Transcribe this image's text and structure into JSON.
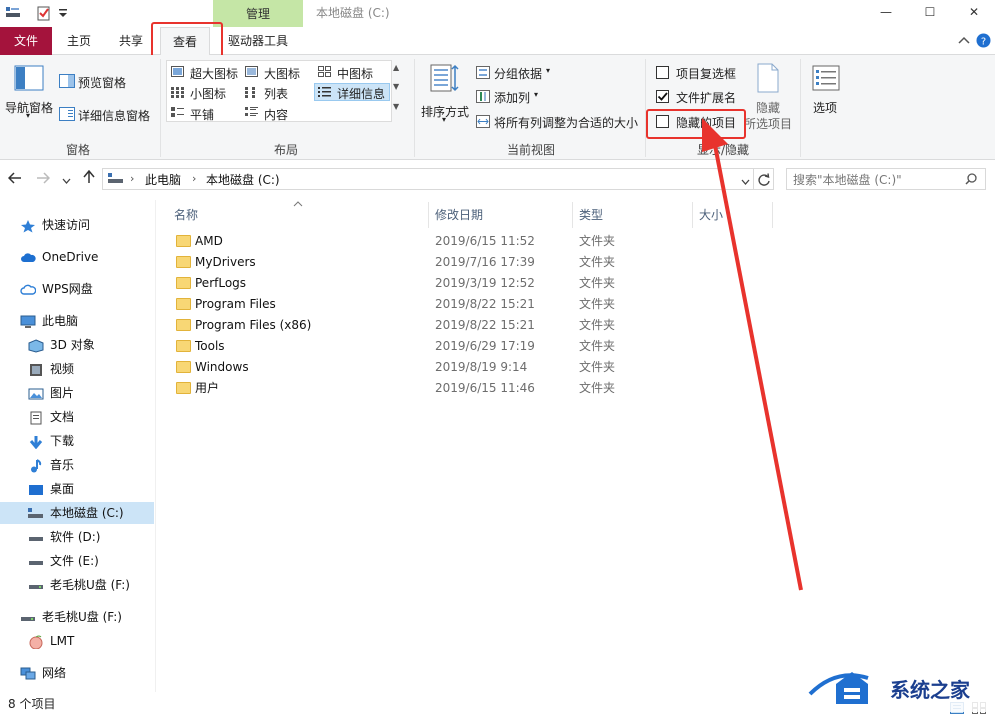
{
  "window": {
    "title": "本地磁盘 (C:)",
    "context_tab": "管理",
    "controls": {
      "minimize": "—",
      "maximize": "☐",
      "close": "✕"
    }
  },
  "tabs": {
    "file": "文件",
    "home": "主页",
    "share": "共享",
    "view": "查看",
    "drive_tools": "驱动器工具"
  },
  "ribbon": {
    "pane": {
      "nav_pane": "导航窗格",
      "preview_pane": "预览窗格",
      "details_pane": "详细信息窗格",
      "label": "窗格"
    },
    "layout": {
      "extra_large": "超大图标",
      "large": "大图标",
      "medium": "中图标",
      "small": "小图标",
      "list": "列表",
      "details": "详细信息",
      "tiles": "平铺",
      "content": "内容",
      "label": "布局"
    },
    "current_view": {
      "sort_by": "排序方式",
      "group_by": "分组依据",
      "add_columns": "添加列",
      "size_all": "将所有列调整为合适的大小",
      "label": "当前视图"
    },
    "show_hide": {
      "item_checkboxes": "项目复选框",
      "item_checkboxes_checked": false,
      "file_extensions": "文件扩展名",
      "file_extensions_checked": true,
      "hidden_items": "隐藏的项目",
      "hidden_items_checked": false,
      "hide_selected_1": "隐藏",
      "hide_selected_2": "所选项目",
      "label": "显示/隐藏"
    },
    "options": "选项"
  },
  "address": {
    "path": [
      "此电脑",
      "本地磁盘 (C:)"
    ],
    "search_placeholder": "搜索\"本地磁盘 (C:)\""
  },
  "sidebar": {
    "quick_access": "快速访问",
    "onedrive": "OneDrive",
    "wps": "WPS网盘",
    "this_pc": "此电脑",
    "pc_items": [
      "3D 对象",
      "视频",
      "图片",
      "文档",
      "下载",
      "音乐",
      "桌面",
      "本地磁盘 (C:)",
      "软件 (D:)",
      "文件 (E:)",
      "老毛桃U盘 (F:)"
    ],
    "usb": "老毛桃U盘 (F:)",
    "lmt": "LMT",
    "network": "网络"
  },
  "columns": {
    "name": "名称",
    "modified": "修改日期",
    "type": "类型",
    "size": "大小"
  },
  "files": [
    {
      "name": "AMD",
      "date": "2019/6/15 11:52",
      "type": "文件夹"
    },
    {
      "name": "MyDrivers",
      "date": "2019/7/16 17:39",
      "type": "文件夹"
    },
    {
      "name": "PerfLogs",
      "date": "2019/3/19 12:52",
      "type": "文件夹"
    },
    {
      "name": "Program Files",
      "date": "2019/8/22 15:21",
      "type": "文件夹"
    },
    {
      "name": "Program Files (x86)",
      "date": "2019/8/22 15:21",
      "type": "文件夹"
    },
    {
      "name": "Tools",
      "date": "2019/6/29 17:19",
      "type": "文件夹"
    },
    {
      "name": "Windows",
      "date": "2019/8/19 9:14",
      "type": "文件夹"
    },
    {
      "name": "用户",
      "date": "2019/6/15 11:46",
      "type": "文件夹"
    }
  ],
  "status": {
    "count": "8 个项目"
  },
  "watermark": "系统之家",
  "colors": {
    "file_tab": "#a4133c",
    "context_tab": "#c5e6a6",
    "highlight": "#e8332d",
    "accent": "#0078d7"
  }
}
